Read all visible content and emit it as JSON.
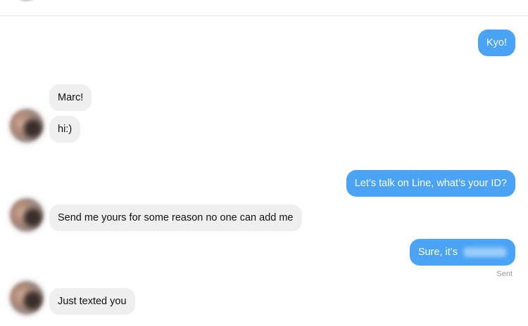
{
  "messages": [
    {
      "sender": "me",
      "text": "Kyo!"
    },
    {
      "sender": "them",
      "text": "Marc!"
    },
    {
      "sender": "them",
      "text": "hi:)"
    },
    {
      "sender": "me",
      "text": "Let’s talk on Line, what’s your ID?"
    },
    {
      "sender": "them",
      "text": "Send me yours for some reason no one can add me"
    },
    {
      "sender": "me",
      "text": "Sure, it’s",
      "redacted_suffix": true
    },
    {
      "sender": "them",
      "text": "Just texted you"
    }
  ],
  "status": {
    "sent_label": "Sent"
  },
  "colors": {
    "outgoing_bubble": "#4aa3f5",
    "incoming_bubble": "#efefef",
    "outgoing_text": "#ffffff",
    "incoming_text": "#111111",
    "status_text": "#9b9b9b"
  },
  "icons": {
    "avatar": "contact-avatar-photo-blurred",
    "redaction": "blurred-redaction"
  }
}
